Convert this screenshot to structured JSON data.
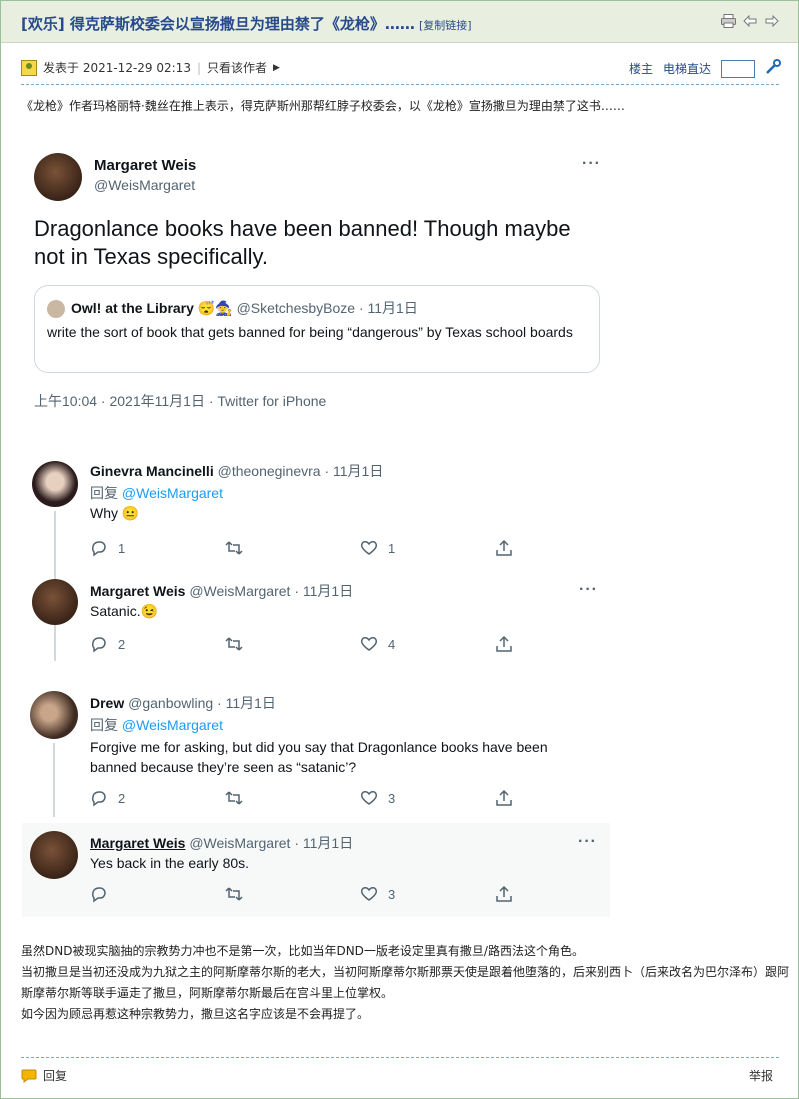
{
  "header": {
    "title": "[欢乐] 得克萨斯校委会以宣扬撒旦为理由禁了《龙枪》……",
    "copy_link": "[复制链接]"
  },
  "post_meta": {
    "posted": "发表于 2021-12-29 02:13",
    "only_author": "只看该作者",
    "floor_label": "楼主",
    "jump_label": "电梯直达"
  },
  "intro": "《龙枪》作者玛格丽特·魏丝在推上表示，得克萨斯州那帮红脖子校委会，以《龙枪》宣扬撒旦为理由禁了这书……",
  "tweet": {
    "name": "Margaret Weis",
    "handle": "@WeisMargaret",
    "text": "Dragonlance books have been banned! Though maybe not in Texas specifically.",
    "quote": {
      "name": "Owl! at the Library",
      "handle": "@SketchesbyBoze · 11月1日",
      "text": "write the sort of book that gets banned for being “dangerous” by Texas school boards"
    },
    "timestamp": "上午10:04 · 2021年11月1日 · Twitter for iPhone"
  },
  "replies1": [
    {
      "name": "Ginevra Mancinelli",
      "handle": "@theoneginevra · 11月1日",
      "reply_to": "回复",
      "reply_handle": "@WeisMargaret",
      "text": "Why",
      "reply_count": "1",
      "retweet_count": "",
      "like_count": "1"
    },
    {
      "name": "Margaret Weis",
      "handle": "@WeisMargaret · 11月1日",
      "text": "Satanic.",
      "reply_count": "2",
      "retweet_count": "",
      "like_count": "4"
    }
  ],
  "replies2": [
    {
      "name": "Drew",
      "handle": "@ganbowling · 11月1日",
      "reply_to": "回复",
      "reply_handle": "@WeisMargaret",
      "text": "Forgive me for asking, but did you say that Dragonlance books have been banned because they’re seen as “satanic’?",
      "reply_count": "2",
      "retweet_count": "",
      "like_count": "3"
    },
    {
      "name": "Margaret Weis",
      "handle": "@WeisMargaret · 11月1日",
      "text": "Yes back in the early 80s.",
      "reply_count": "",
      "retweet_count": "",
      "like_count": "3"
    }
  ],
  "body": [
    "虽然DND被现实脑抽的宗教势力冲也不是第一次，比如当年DND一版老设定里真有撒旦/路西法这个角色。",
    "当初撒旦是当初还没成为九狱之主的阿斯摩蒂尔斯的老大，当初阿斯摩蒂尔斯那票天使是跟着他堕落的，后来别西卜（后来改名为巴尔泽布）跟阿斯摩蒂尔斯等联手逼走了撒旦，阿斯摩蒂尔斯最后在宫斗里上位掌权。",
    "如今因为顾忌再惹这种宗教势力，撒旦这名字应该是不会再提了。"
  ],
  "footer": {
    "reply": "回复",
    "report": "举报"
  },
  "colors": {
    "accent": "#274a8a",
    "twitter_blue": "#1d9bf0",
    "forum_bg": "#e9efe0"
  }
}
